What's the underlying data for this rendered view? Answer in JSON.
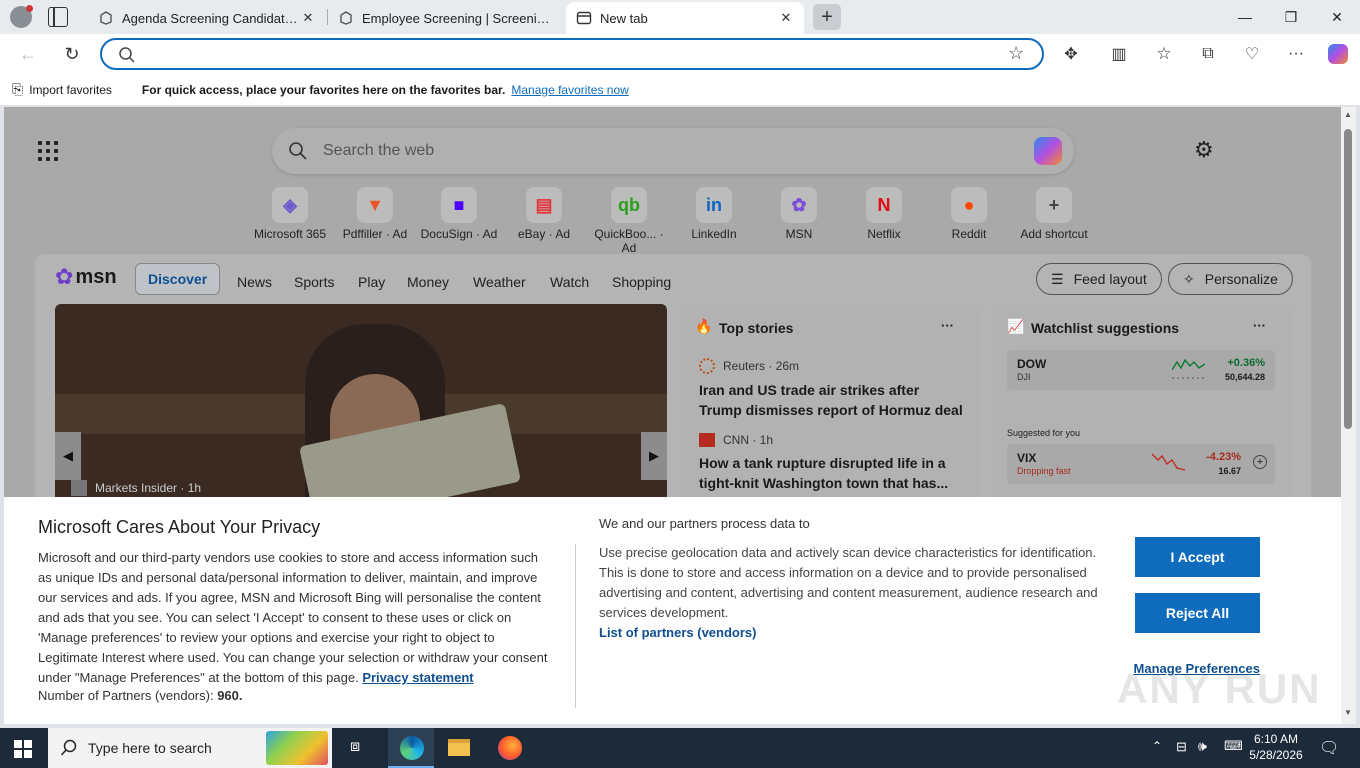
{
  "tabs": [
    {
      "title": "Agenda Screening Candidate Hub"
    },
    {
      "title": "Employee Screening | Screening S"
    },
    {
      "title": "New tab"
    }
  ],
  "address": {
    "value": ""
  },
  "favbar": {
    "import_label": "Import favorites",
    "hint": "For quick access, place your favorites here on the favorites bar.",
    "manage_link": "Manage favorites now"
  },
  "ntp": {
    "search_placeholder": "Search the web",
    "shortcuts": [
      {
        "label": "Microsoft 365",
        "glyph": "◈",
        "color": "#6a5acd"
      },
      {
        "label": "Pdffiller · Ad",
        "glyph": "▼",
        "color": "#e8572a"
      },
      {
        "label": "DocuSign · Ad",
        "glyph": "■",
        "color": "#4c00ff"
      },
      {
        "label": "eBay · Ad",
        "glyph": "▤",
        "color": "#e53238"
      },
      {
        "label": "QuickBoo... · Ad",
        "glyph": "qb",
        "color": "#2ca01c"
      },
      {
        "label": "LinkedIn",
        "glyph": "in",
        "color": "#0a66c2"
      },
      {
        "label": "MSN",
        "glyph": "✿",
        "color": "#7b4fd8"
      },
      {
        "label": "Netflix",
        "glyph": "N",
        "color": "#e50914"
      },
      {
        "label": "Reddit",
        "glyph": "●",
        "color": "#ff4500"
      },
      {
        "label": "Add shortcut",
        "glyph": "+",
        "color": "#444444"
      }
    ]
  },
  "feed": {
    "brand": "msn",
    "nav": [
      "Discover",
      "News",
      "Sports",
      "Play",
      "Money",
      "Weather",
      "Watch",
      "Shopping"
    ],
    "feed_layout": "Feed layout",
    "personalize": "Personalize",
    "hero": {
      "source": "Markets Insider · 1h"
    },
    "top_stories": {
      "title": "Top stories",
      "items": [
        {
          "source": "Reuters · 26m",
          "headline": "Iran and US trade air strikes after Trump dismisses report of Hormuz deal"
        },
        {
          "source": "CNN · 1h",
          "headline": "How a tank rupture disrupted life in a tight-knit Washington town that has..."
        }
      ]
    },
    "watchlist": {
      "title": "Watchlist suggestions",
      "dow": {
        "symbol": "DOW",
        "sub": "DJI",
        "change": "+0.36%",
        "price": "50,644.28"
      },
      "suggested": "Suggested for you",
      "vix": {
        "symbol": "VIX",
        "sub": "Dropping fast",
        "change": "-4.23%",
        "price": "16.67"
      }
    }
  },
  "privacy": {
    "title": "Microsoft Cares About Your Privacy",
    "body": "Microsoft and our third-party vendors use cookies to store and access information such as unique IDs and personal data/personal information to deliver, maintain, and improve our services and ads. If you agree, MSN and Microsoft Bing will personalise the content and ads that you see. You can select 'I Accept' to consent to these uses or click on 'Manage preferences' to review your options and exercise your right to object to Legitimate Interest where used. You can change your selection or withdraw your consent under \"Manage Preferences\" at the bottom of this page.",
    "privacy_link": "Privacy statement",
    "partners_prefix": "Number of Partners (vendors):",
    "partners_count": "960.",
    "right_title": "We and our partners process data to",
    "right_body": "Use precise geolocation data and actively scan device characteristics for identification. This is done to store and access information on a device and to provide personalised advertising and content, advertising and content measurement, audience research and services development.",
    "partners_link": "List of partners (vendors)",
    "accept": "I Accept",
    "reject": "Reject All",
    "manage": "Manage Preferences"
  },
  "watermark": "ANY RUN",
  "taskbar": {
    "search_placeholder": "Type here to search",
    "time": "6:10 AM",
    "date": "5/28/2026"
  },
  "colors": {
    "accent": "#0f6cbd",
    "positive": "#0a7a34",
    "negative": "#c42b1c"
  }
}
